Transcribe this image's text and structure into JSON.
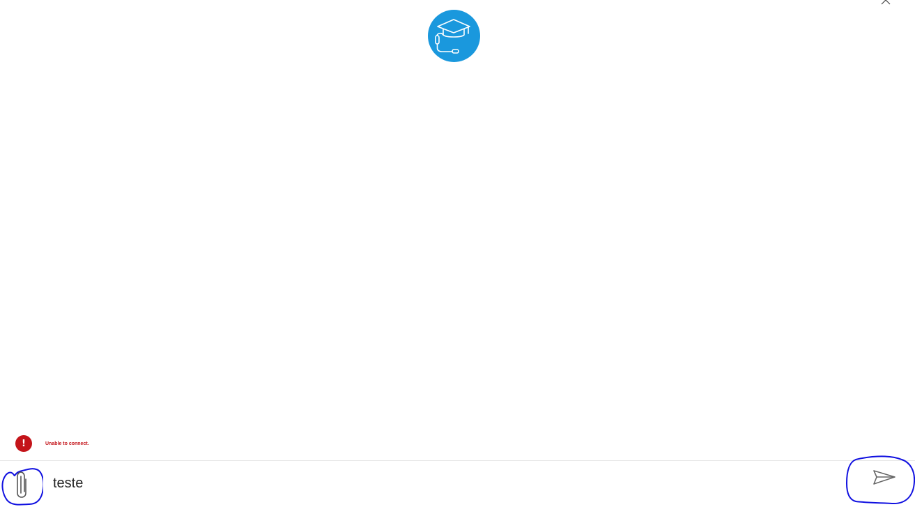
{
  "window": {
    "close_icon": "close-icon"
  },
  "bot": {
    "avatar_icon": "graduation-cap-headset-icon",
    "avatar_color": "#1a98dd"
  },
  "status": {
    "icon": "error-icon",
    "icon_glyph": "!",
    "message": "Unable to connect.",
    "color": "#c4141a"
  },
  "composer": {
    "attach_icon": "paperclip-icon",
    "input_value": "teste",
    "send_icon": "send-icon",
    "annotation_color": "#1010e0"
  }
}
